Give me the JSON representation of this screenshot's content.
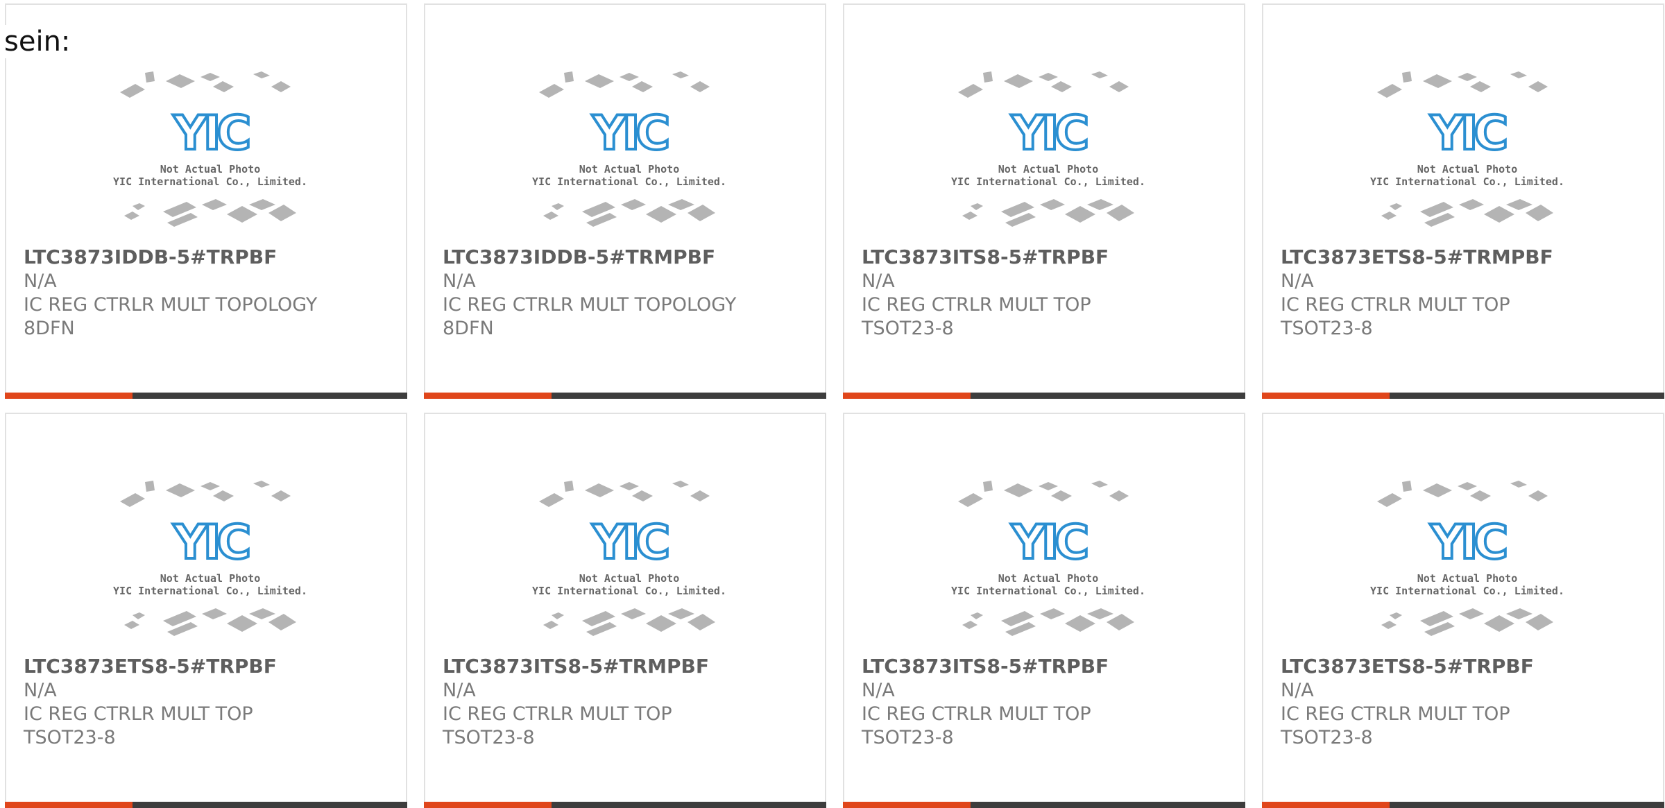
{
  "intro_text": "sein:",
  "colors": {
    "accent": "#e0461b",
    "bar": "#3d3d3d",
    "border": "#e1e1e1",
    "logo_blue": "#2b8fd1",
    "chip_gray": "#b4b4b4"
  },
  "placeholder": {
    "logo": "YIC",
    "caption_line1": "Not Actual Photo",
    "caption_line2": "YIC International Co., Limited."
  },
  "products": [
    {
      "part": "LTC3873IDDB-5#TRPBF",
      "mfr": "N/A",
      "desc": "IC REG CTRLR MULT TOPOLOGY",
      "pkg": "8DFN"
    },
    {
      "part": "LTC3873IDDB-5#TRMPBF",
      "mfr": "N/A",
      "desc": "IC REG CTRLR MULT TOPOLOGY",
      "pkg": "8DFN"
    },
    {
      "part": "LTC3873ITS8-5#TRPBF",
      "mfr": "N/A",
      "desc": "IC REG CTRLR MULT TOP",
      "pkg": "TSOT23-8"
    },
    {
      "part": "LTC3873ETS8-5#TRMPBF",
      "mfr": "N/A",
      "desc": "IC REG CTRLR MULT TOP",
      "pkg": "TSOT23-8"
    },
    {
      "part": "LTC3873ETS8-5#TRPBF",
      "mfr": "N/A",
      "desc": "IC REG CTRLR MULT TOP",
      "pkg": "TSOT23-8"
    },
    {
      "part": "LTC3873ITS8-5#TRMPBF",
      "mfr": "N/A",
      "desc": "IC REG CTRLR MULT TOP",
      "pkg": "TSOT23-8"
    },
    {
      "part": "LTC3873ITS8-5#TRPBF",
      "mfr": "N/A",
      "desc": "IC REG CTRLR MULT TOP",
      "pkg": "TSOT23-8"
    },
    {
      "part": "LTC3873ETS8-5#TRPBF",
      "mfr": "N/A",
      "desc": "IC REG CTRLR MULT TOP",
      "pkg": "TSOT23-8"
    }
  ]
}
